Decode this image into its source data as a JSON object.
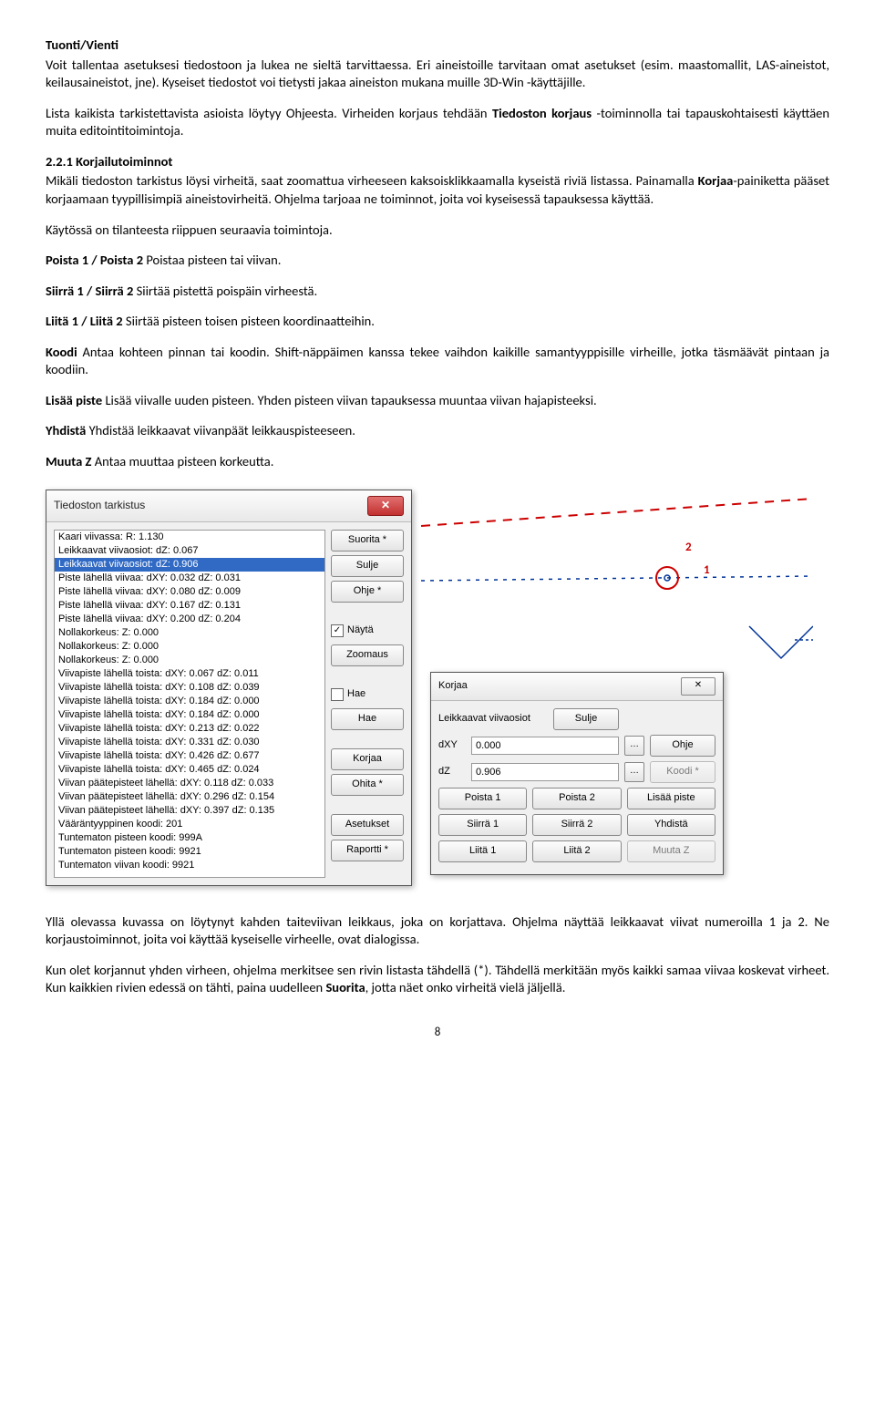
{
  "h1": "Tuonti/Vienti",
  "p1a": "Voit tallentaa asetuksesi tiedostoon ja lukea ne sieltä tarvittaessa. Eri aineistoille tarvitaan omat asetukset (esim. maastomallit, LAS-aineistot, keilausaineistot, jne). Kyseiset tiedostot voi tietysti jakaa aineiston mukana muille 3D-Win -käyttäjille.",
  "p1b": "Lista kaikista tarkistettavista asioista löytyy Ohjeesta. Virheiden korjaus tehdään ",
  "p1b_bold": "Tiedoston korjaus",
  "p1b_after": " -toiminnolla tai tapauskohtaisesti käyttäen muita editointitoimintoja.",
  "h2": "2.2.1 Korjailutoiminnot",
  "p2": "Mikäli tiedoston tarkistus löysi virheitä, saat zoomattua virheeseen kaksoisklikkaamalla kyseistä riviä listassa. Painamalla ",
  "p2_bold": "Korjaa",
  "p2_after": "-painiketta pääset korjaamaan tyypillisimpiä aineistovirheitä. Ohjelma tarjoaa ne toiminnot, joita voi kyseisessä tapauksessa käyttää.",
  "p3": "Käytössä on tilanteesta riippuen seuraavia toimintoja.",
  "cmd1_b": "Poista 1 / Poista 2",
  "cmd1_t": "  Poistaa pisteen tai viivan.",
  "cmd2_b": "Siirrä 1 / Siirrä 2",
  "cmd2_t": "  Siirtää pistettä poispäin virheestä.",
  "cmd3_b": "Liitä 1 / Liitä 2",
  "cmd3_t": " Siirtää pisteen toisen pisteen koordinaatteihin.",
  "cmd4_b": "Koodi",
  "cmd4_t": " Antaa kohteen pinnan tai koodin. Shift-näppäimen kanssa tekee vaihdon kaikille samantyyppisille virheille, jotka täsmäävät pintaan ja koodiin.",
  "cmd5_b": "Lisää piste",
  "cmd5_t": " Lisää viivalle uuden pisteen. Yhden pisteen viivan tapauksessa muuntaa viivan hajapisteeksi.",
  "cmd6_b": "Yhdistä",
  "cmd6_t": " Yhdistää leikkaavat viivanpäät leikkauspisteeseen.",
  "cmd7_b": "Muuta Z",
  "cmd7_t": " Antaa muuttaa pisteen korkeutta.",
  "dlg_title": "Tiedoston tarkistus",
  "list": [
    "Kaari viivassa:   R: 1.130",
    "Leikkaavat viivaosiot:   dZ: 0.067",
    "Leikkaavat viivaosiot:   dZ: 0.906",
    "Piste lähellä viivaa:   dXY: 0.032  dZ: 0.031",
    "Piste lähellä viivaa:   dXY: 0.080  dZ: 0.009",
    "Piste lähellä viivaa:   dXY: 0.167  dZ: 0.131",
    "Piste lähellä viivaa:   dXY: 0.200  dZ: 0.204",
    "Nollakorkeus:   Z: 0.000",
    "Nollakorkeus:   Z: 0.000",
    "Nollakorkeus:   Z: 0.000",
    "Viivapiste lähellä toista:   dXY: 0.067  dZ: 0.011",
    "Viivapiste lähellä toista:   dXY: 0.108  dZ: 0.039",
    "Viivapiste lähellä toista:   dXY: 0.184  dZ: 0.000",
    "Viivapiste lähellä toista:   dXY: 0.184  dZ: 0.000",
    "Viivapiste lähellä toista:   dXY: 0.213  dZ: 0.022",
    "Viivapiste lähellä toista:   dXY: 0.331  dZ: 0.030",
    "Viivapiste lähellä toista:   dXY: 0.426  dZ: 0.677",
    "Viivapiste lähellä toista:   dXY: 0.465  dZ: 0.024",
    "Viivan päätepisteet lähellä:   dXY: 0.118  dZ: 0.033",
    "Viivan päätepisteet lähellä:   dXY: 0.296  dZ: 0.154",
    "Viivan päätepisteet lähellä:   dXY: 0.397  dZ: 0.135",
    "Vääräntyyppinen koodi:   201",
    "Tuntematon pisteen koodi:   999A",
    "Tuntematon pisteen koodi:   9921",
    "Tuntematon viivan koodi:   9921"
  ],
  "list_sel_index": 2,
  "btncol": {
    "suorita": "Suorita *",
    "sulje": "Sulje",
    "ohje": "Ohje *",
    "nayta": "Näytä",
    "zoomaus": "Zoomaus",
    "hae_chk": "Hae",
    "hae_btn": "Hae",
    "korjaa": "Korjaa",
    "ohita": "Ohita *",
    "asetukset": "Asetukset",
    "raportti": "Raportti *"
  },
  "canvas_labels": {
    "one": "1",
    "two": "2"
  },
  "dlg2": {
    "title": "Korjaa",
    "desc": "Leikkaavat viivaosiot",
    "dxy": "dXY",
    "dxy_val": "0.000",
    "dz": "dZ",
    "dz_val": "0.906",
    "sulje": "Sulje",
    "ohje": "Ohje",
    "koodi": "Koodi *",
    "poista1": "Poista 1",
    "poista2": "Poista 2",
    "lisaa": "Lisää piste",
    "siirra1": "Siirrä 1",
    "siirra2": "Siirrä 2",
    "yhdista": "Yhdistä",
    "liita1": "Liitä 1",
    "liita2": "Liitä 2",
    "muutaz": "Muuta Z"
  },
  "p_end1": "Yllä olevassa kuvassa on löytynyt kahden taiteviivan leikkaus, joka on korjattava. Ohjelma näyttää leikkaavat viivat numeroilla 1 ja 2. Ne korjaustoiminnot, joita voi käyttää kyseiselle virheelle, ovat dialogissa.",
  "p_end2a": "Kun olet korjannut yhden virheen, ohjelma merkitsee sen rivin listasta tähdellä (*). Tähdellä merkitään myös kaikki samaa viivaa koskevat virheet. Kun kaikkien rivien edessä on tähti, paina uudelleen ",
  "p_end2_bold": "Suorita",
  "p_end2b": ", jotta näet onko virheitä vielä jäljellä.",
  "pagenum": "8"
}
